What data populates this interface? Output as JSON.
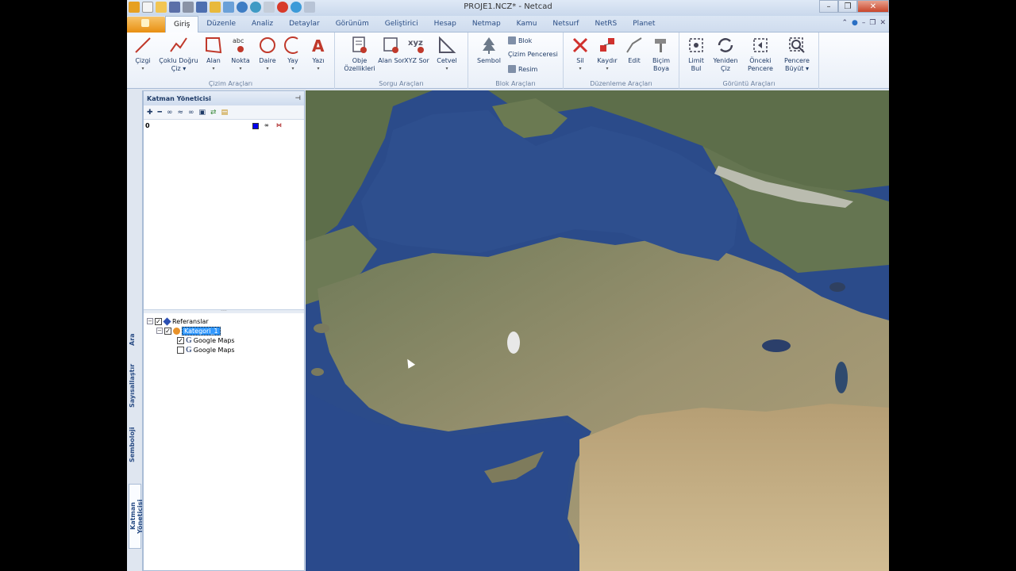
{
  "window": {
    "title": "PROJE1.NCZ* - Netcad",
    "controls": [
      "–",
      "❐",
      "✕"
    ]
  },
  "tabs": [
    "Giriş",
    "Düzenle",
    "Analiz",
    "Detaylar",
    "Görünüm",
    "Geliştirici",
    "Hesap",
    "Netmap",
    "Kamu",
    "Netsurf",
    "NetRS",
    "Planet"
  ],
  "active_tab": "Giriş",
  "ribbon": {
    "groups": [
      {
        "label": "Çizim Araçları",
        "buttons": [
          "Çizgi",
          "Çoklu Doğru Çiz",
          "Alan",
          "Nokta",
          "Daire",
          "Yay",
          "Yazı"
        ]
      },
      {
        "label": "Sorgu Araçları",
        "buttons": [
          "Obje Özellikleri",
          "Alan Sor",
          "XYZ Sor",
          "Cetvel"
        ]
      },
      {
        "label": "Blok Araçları",
        "buttons": [
          "Sembol"
        ],
        "small": [
          "Blok",
          "Çizim Penceresi",
          "Resim"
        ]
      },
      {
        "label": "Düzenleme Araçları",
        "buttons": [
          "Sil",
          "Kaydır",
          "Edit",
          "Biçim Boya"
        ]
      },
      {
        "label": "Görüntü Araçları",
        "buttons": [
          "Limit Bul",
          "Yeniden Çiz",
          "Önceki Pencere",
          "Pencere Büyüt"
        ]
      }
    ]
  },
  "side_tabs": [
    "Ara",
    "Sayısallaştır",
    "Semboloji",
    "Katman Yöneticisi"
  ],
  "panel": {
    "title": "Katman Yöneticisi",
    "layer": {
      "name": "0",
      "color": "#0000ee"
    },
    "tree": {
      "root": "Referanslar",
      "category": "Kategori_1",
      "items": [
        "Google Maps",
        "Google Maps"
      ]
    }
  },
  "map": {
    "colors": {
      "sea": "#2e4f8e",
      "land": "#8c8a6a",
      "desert": "#c8b48a",
      "forest": "#4f6a3c"
    }
  }
}
